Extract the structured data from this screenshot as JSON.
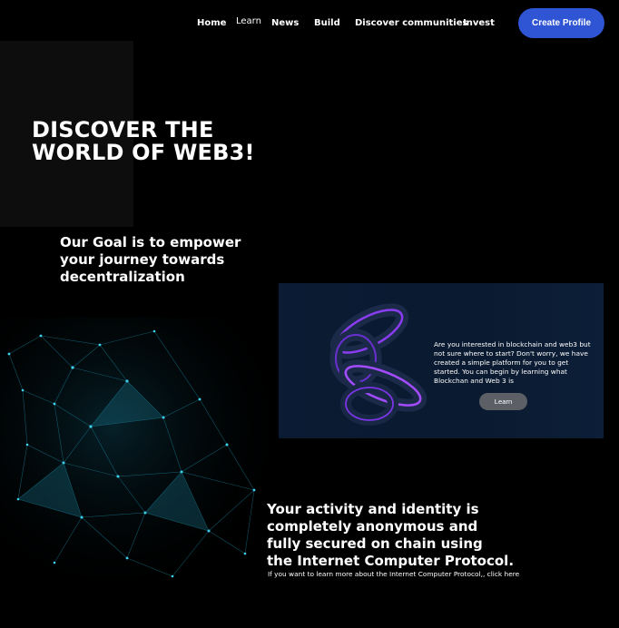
{
  "nav": {
    "items": [
      {
        "label": "Home"
      },
      {
        "label": "Learn"
      },
      {
        "label": "News"
      },
      {
        "label": "Build"
      },
      {
        "label": "Discover communities"
      },
      {
        "label": "Invest"
      }
    ],
    "cta_label": "Create Profile"
  },
  "hero": {
    "title_line1": "DISCOVER THE",
    "title_line2": "WORLD OF WEB3!",
    "goal_line1": "Our Goal is to empower",
    "goal_line2": "your journey towards",
    "goal_line3": "decentralization"
  },
  "card": {
    "text": "Are you interested in blockchain and web3 but not sure where to start? Don't worry, we have created a simple platform for you to get started. You can begin by learning what Blockchan and Web 3 is",
    "button_label": "Learn"
  },
  "security": {
    "line1": "Your activity and identity is",
    "line2": "completely anonymous and",
    "line3": "fully secured on chain using",
    "line4": "the Internet Computer Protocol.",
    "note": "If you want to learn more about the Internet Computer Protocol,, click here"
  },
  "colors": {
    "accent": "#2f55d4",
    "background": "#000000",
    "card_background": "#0b1b33",
    "ring_glow": "#8a3cf0",
    "network": "#1fb6d6"
  }
}
